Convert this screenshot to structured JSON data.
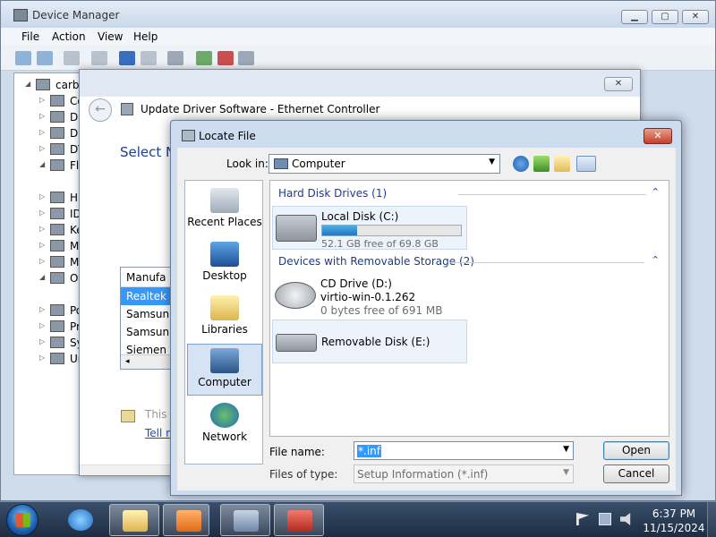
{
  "device_manager": {
    "title": "Device Manager",
    "menu": [
      "File",
      "Action",
      "View",
      "Help"
    ],
    "tree_root": "carbo",
    "tree_items": [
      "Co",
      "Di",
      "Di",
      "DV",
      "Fl",
      "Hu",
      "ID",
      "Ke",
      "Mi",
      "Mo",
      "Ot",
      "Po",
      "Pr",
      "Sy",
      "Un"
    ]
  },
  "update_driver": {
    "title": "Update Driver Software - Ethernet Controller",
    "heading": "Select N",
    "list_header": "Manufa",
    "list_items": [
      "Realtek",
      "Samsun",
      "Samsun",
      "Siemen"
    ],
    "note": "This",
    "link": "Tell m"
  },
  "locate_file": {
    "title": "Locate File",
    "look_in_label": "Look in:",
    "look_in_value": "Computer",
    "places": [
      "Recent Places",
      "Desktop",
      "Libraries",
      "Computer",
      "Network"
    ],
    "groups": {
      "hard_disk": "Hard Disk Drives (1)",
      "removable": "Devices with Removable Storage (2)"
    },
    "drives": {
      "local": {
        "name": "Local Disk (C:)",
        "free": "52.1 GB free of 69.8 GB",
        "used_fraction": 0.25
      },
      "cd": {
        "name": "CD Drive (D:)",
        "label": "virtio-win-0.1.262",
        "free": "0 bytes free of 691 MB"
      },
      "removable": {
        "name": "Removable Disk (E:)"
      }
    },
    "file_name_label": "File name:",
    "file_name_value": "*.inf",
    "file_type_label": "Files of type:",
    "file_type_value": "Setup Information (*.inf)",
    "open_label": "Open",
    "cancel_label": "Cancel",
    "close_glyph": "✕"
  },
  "taskbar": {
    "time": "6:37 PM",
    "date": "11/15/2024"
  }
}
